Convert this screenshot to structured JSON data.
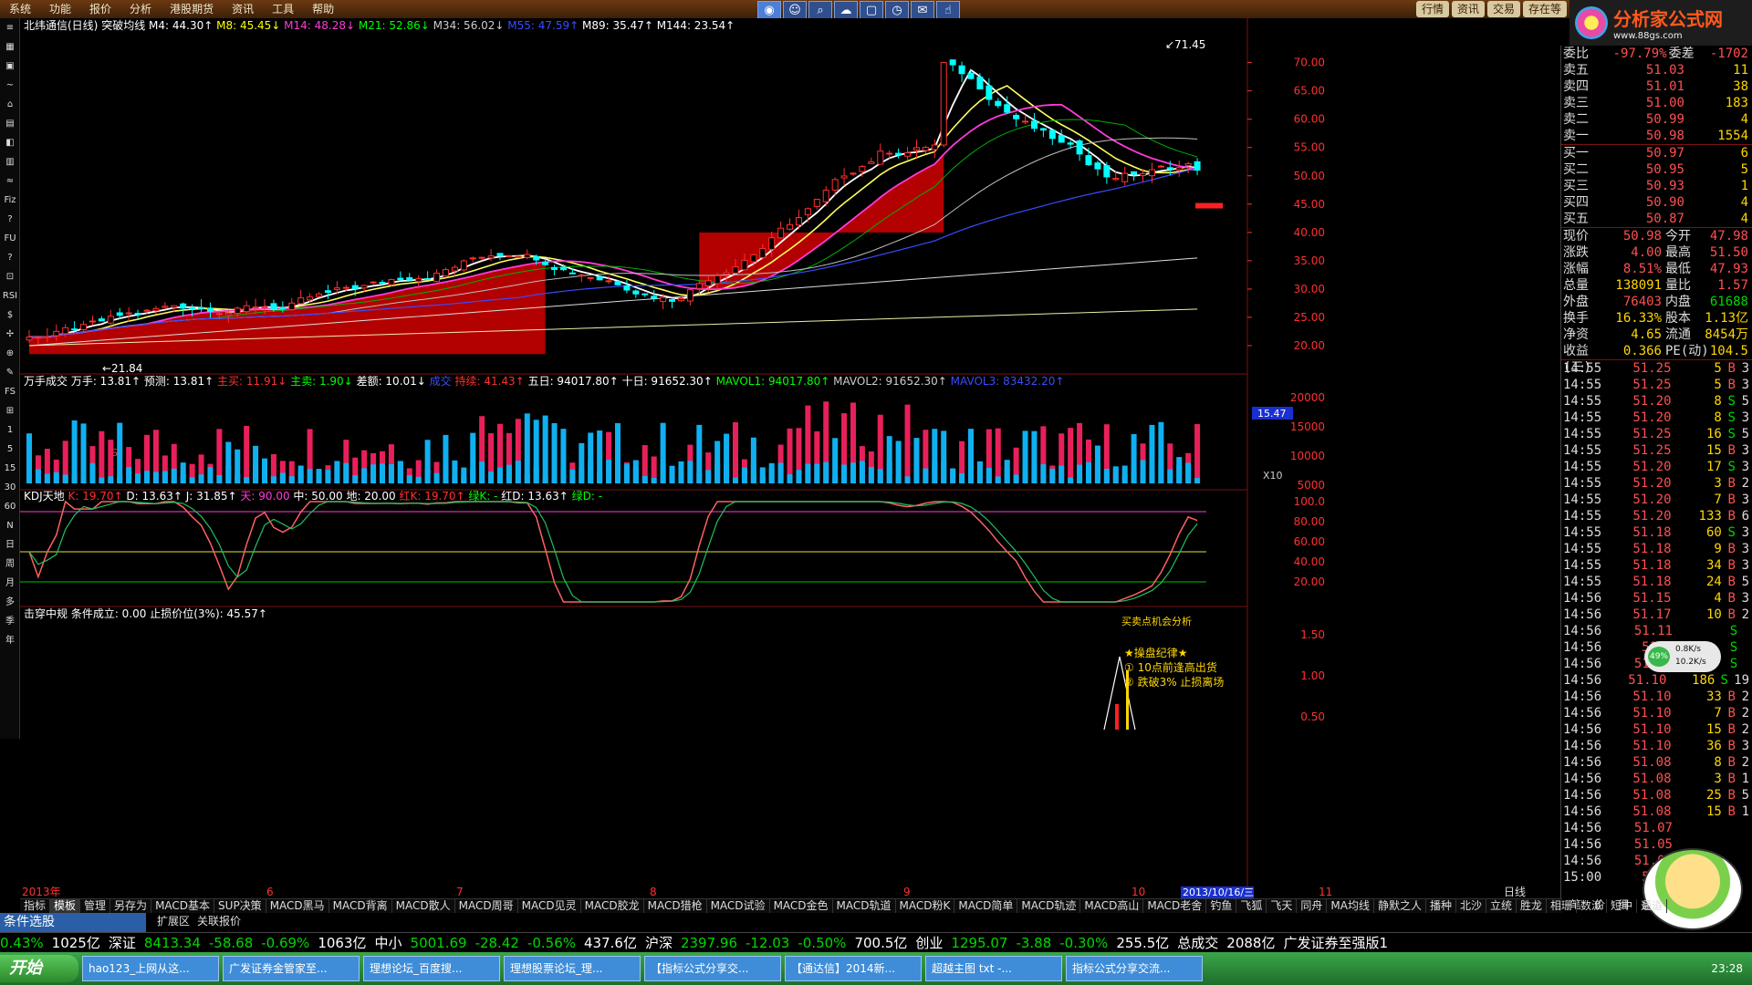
{
  "menu": [
    "系统",
    "功能",
    "报价",
    "分析",
    "港股期货",
    "资讯",
    "工具",
    "帮助"
  ],
  "top_tools": [
    "search-icon",
    "person-icon",
    "magnifier-icon",
    "cloud-icon",
    "window-icon",
    "clock-icon",
    "mail-icon",
    "gesture-icon"
  ],
  "top_tabs": [
    "行情",
    "资讯",
    "交易",
    "存在等"
  ],
  "logo": {
    "title": "分析家公式网",
    "url": "www.88gs.com"
  },
  "left_tools": [
    "≡",
    "▦",
    "▣",
    "~",
    "⌂",
    "▤",
    "◧",
    "▥",
    "≈",
    "Fiz",
    "?",
    "FU",
    "?",
    "⊡",
    "RSI",
    "$",
    "✢",
    "⊕",
    "✎",
    "FS",
    "⊞",
    "1",
    "5",
    "15",
    "30",
    "60",
    "N",
    "日",
    "周",
    "月",
    "多",
    "季",
    "年"
  ],
  "main_header": {
    "name": "北纬通信(日线)",
    "formula": "突破均线",
    "mas": [
      {
        "label": "M4: 44.30",
        "arrow": "↑",
        "color": "#ffffff"
      },
      {
        "label": "M8: 45.45",
        "arrow": "↓",
        "color": "#ffff00"
      },
      {
        "label": "M14: 48.28",
        "arrow": "↓",
        "color": "#ff3bd8"
      },
      {
        "label": "M21: 52.86",
        "arrow": "↓",
        "color": "#00ff00"
      },
      {
        "label": "M34: 56.02",
        "arrow": "↓",
        "color": "#cccccc"
      },
      {
        "label": "M55: 47.59",
        "arrow": "↑",
        "color": "#3a4cff"
      },
      {
        "label": "M89: 35.47",
        "arrow": "↑",
        "color": "#ffffff"
      },
      {
        "label": "M144: 23.54",
        "arrow": "↑",
        "color": "#ffffff"
      }
    ]
  },
  "vol_header": [
    {
      "t": "万手成交",
      "c": "#ffffff"
    },
    {
      "t": "万手: 13.81↑",
      "c": "#ffffff"
    },
    {
      "t": "预测: 13.81↑",
      "c": "#ffffff"
    },
    {
      "t": "主买: 11.91↓",
      "c": "#ff3030"
    },
    {
      "t": "主卖: 1.90↓",
      "c": "#00ff00"
    },
    {
      "t": "差额: 10.01↓",
      "c": "#ffffff"
    },
    {
      "t": "成交",
      "c": "#3a4cff"
    },
    {
      "t": "持续: 41.43↑",
      "c": "#ff3030"
    },
    {
      "t": "五日: 94017.80↑",
      "c": "#ffffff"
    },
    {
      "t": "十日: 91652.30↑",
      "c": "#ffffff"
    },
    {
      "t": "MAVOL1: 94017.80↑",
      "c": "#00ff00"
    },
    {
      "t": "MAVOL2: 91652.30↑",
      "c": "#cccccc"
    },
    {
      "t": "MAVOL3: 83432.20↑",
      "c": "#3a4cff"
    }
  ],
  "kdj_header": [
    {
      "t": "KDJ天地",
      "c": "#ffffff"
    },
    {
      "t": "K: 19.70↑",
      "c": "#ff3030"
    },
    {
      "t": "D: 13.63↑",
      "c": "#ffffff"
    },
    {
      "t": "J: 31.85↑",
      "c": "#ffffff"
    },
    {
      "t": "天: 90.00",
      "c": "#ff3bd8"
    },
    {
      "t": "中: 50.00",
      "c": "#ffffff"
    },
    {
      "t": "地: 20.00",
      "c": "#ffffff"
    },
    {
      "t": "红K: 19.70↑",
      "c": "#ff3030"
    },
    {
      "t": "绿K: -",
      "c": "#00ff00"
    },
    {
      "t": "红D: 13.63↑",
      "c": "#ffffff"
    },
    {
      "t": "绿D: -",
      "c": "#00ff00"
    }
  ],
  "sig_header": [
    {
      "t": "击穿中规",
      "c": "#ffffff"
    },
    {
      "t": "条件成立: 0.00",
      "c": "#ffffff"
    },
    {
      "t": "止损价位(3%): 45.57↑",
      "c": "#ffffff"
    }
  ],
  "sig_note": {
    "title": "★操盘纪律★",
    "l1": "① 10点前逢高出货",
    "l2": "② 跌破3% 止损离场",
    "partial": "买卖点机会分析"
  },
  "annotations": {
    "high": "71.45",
    "low": "21.84",
    "marker_s": "S",
    "price_tag": "15.47",
    "x10": "X10",
    "date_tag": "2013/10/16/三",
    "right_label": "日线"
  },
  "price_axis": [
    "70.00",
    "65.00",
    "60.00",
    "55.00",
    "50.00",
    "45.00",
    "40.00",
    "35.00",
    "30.00",
    "25.00",
    "20.00"
  ],
  "vol_axis": [
    "20000",
    "15000",
    "10000",
    "5000"
  ],
  "kdj_axis": [
    "100.0",
    "80.00",
    "60.00",
    "40.00",
    "20.00"
  ],
  "sig_axis": [
    "1.50",
    "1.00",
    "0.50"
  ],
  "month_labels": [
    "2013年",
    "6",
    "7",
    "8",
    "9",
    "10",
    "11"
  ],
  "colors": {
    "up": "#ff3030",
    "down": "#00ffff",
    "fill": "#b30000"
  },
  "quote": {
    "weibi": {
      "l": "委比",
      "v": "-97.79%",
      "l2": "委差",
      "v2": "-1702"
    },
    "sells": [
      {
        "l": "卖五",
        "p": "51.03",
        "v": "11"
      },
      {
        "l": "卖四",
        "p": "51.01",
        "v": "38"
      },
      {
        "l": "卖三",
        "p": "51.00",
        "v": "183"
      },
      {
        "l": "卖二",
        "p": "50.99",
        "v": "4"
      },
      {
        "l": "卖一",
        "p": "50.98",
        "v": "1554"
      }
    ],
    "buys": [
      {
        "l": "买一",
        "p": "50.97",
        "v": "6"
      },
      {
        "l": "买二",
        "p": "50.95",
        "v": "5"
      },
      {
        "l": "买三",
        "p": "50.93",
        "v": "1"
      },
      {
        "l": "买四",
        "p": "50.90",
        "v": "4"
      },
      {
        "l": "买五",
        "p": "50.87",
        "v": "4"
      }
    ],
    "stats": [
      {
        "a": "现价",
        "b": "50.98",
        "bc": "red",
        "c": "今开",
        "d": "47.98",
        "dc": "red"
      },
      {
        "a": "涨跌",
        "b": "4.00",
        "bc": "red",
        "c": "最高",
        "d": "51.50",
        "dc": "red"
      },
      {
        "a": "涨幅",
        "b": "8.51%",
        "bc": "red",
        "c": "最低",
        "d": "47.93",
        "dc": "red"
      },
      {
        "a": "总量",
        "b": "138091",
        "bc": "yellow",
        "c": "量比",
        "d": "1.57",
        "dc": "red"
      },
      {
        "a": "外盘",
        "b": "76403",
        "bc": "red",
        "c": "内盘",
        "d": "61688",
        "dc": "green"
      },
      {
        "a": "换手",
        "b": "16.33%",
        "bc": "yellow",
        "c": "股本",
        "d": "1.13亿",
        "dc": "yellow"
      },
      {
        "a": "净资",
        "b": "4.65",
        "bc": "yellow",
        "c": "流通",
        "d": "8454万",
        "dc": "yellow"
      },
      {
        "a": "收益(三)",
        "b": "0.366",
        "bc": "yellow",
        "c": "PE(动)",
        "d": "104.5",
        "dc": "yellow"
      }
    ],
    "ticks": [
      {
        "t": "14:55",
        "p": "51.25",
        "v": "5",
        "bs": "B",
        "n": "3"
      },
      {
        "t": "14:55",
        "p": "51.25",
        "v": "5",
        "bs": "B",
        "n": "3"
      },
      {
        "t": "14:55",
        "p": "51.20",
        "v": "8",
        "bs": "S",
        "n": "5"
      },
      {
        "t": "14:55",
        "p": "51.20",
        "v": "8",
        "bs": "S",
        "n": "3"
      },
      {
        "t": "14:55",
        "p": "51.25",
        "v": "16",
        "bs": "S",
        "n": "5"
      },
      {
        "t": "14:55",
        "p": "51.25",
        "v": "15",
        "bs": "B",
        "n": "3"
      },
      {
        "t": "14:55",
        "p": "51.20",
        "v": "17",
        "bs": "S",
        "n": "3"
      },
      {
        "t": "14:55",
        "p": "51.20",
        "v": "3",
        "bs": "B",
        "n": "2"
      },
      {
        "t": "14:55",
        "p": "51.20",
        "v": "7",
        "bs": "B",
        "n": "3"
      },
      {
        "t": "14:55",
        "p": "51.20",
        "v": "133",
        "bs": "B",
        "n": "6"
      },
      {
        "t": "14:55",
        "p": "51.18",
        "v": "60",
        "bs": "S",
        "n": "3"
      },
      {
        "t": "14:55",
        "p": "51.18",
        "v": "9",
        "bs": "B",
        "n": "3"
      },
      {
        "t": "14:55",
        "p": "51.18",
        "v": "34",
        "bs": "B",
        "n": "3"
      },
      {
        "t": "14:55",
        "p": "51.18",
        "v": "24",
        "bs": "B",
        "n": "5"
      },
      {
        "t": "14:56",
        "p": "51.15",
        "v": "4",
        "bs": "B",
        "n": "3"
      },
      {
        "t": "14:56",
        "p": "51.17",
        "v": "10",
        "bs": "B",
        "n": "2"
      },
      {
        "t": "14:56",
        "p": "51.11",
        "v": "",
        "bs": "S",
        "n": ""
      },
      {
        "t": "14:56",
        "p": "51.1",
        "v": "",
        "bs": "S",
        "n": ""
      },
      {
        "t": "14:56",
        "p": "51.15",
        "v": "",
        "bs": "S",
        "n": ""
      },
      {
        "t": "14:56",
        "p": "51.10",
        "v": "186",
        "bs": "S",
        "n": "19"
      },
      {
        "t": "14:56",
        "p": "51.10",
        "v": "33",
        "bs": "B",
        "n": "2"
      },
      {
        "t": "14:56",
        "p": "51.10",
        "v": "7",
        "bs": "B",
        "n": "2"
      },
      {
        "t": "14:56",
        "p": "51.10",
        "v": "15",
        "bs": "B",
        "n": "2"
      },
      {
        "t": "14:56",
        "p": "51.10",
        "v": "36",
        "bs": "B",
        "n": "3"
      },
      {
        "t": "14:56",
        "p": "51.08",
        "v": "8",
        "bs": "B",
        "n": "2"
      },
      {
        "t": "14:56",
        "p": "51.08",
        "v": "3",
        "bs": "B",
        "n": "1"
      },
      {
        "t": "14:56",
        "p": "51.08",
        "v": "25",
        "bs": "B",
        "n": "5"
      },
      {
        "t": "14:56",
        "p": "51.08",
        "v": "15",
        "bs": "B",
        "n": "1"
      },
      {
        "t": "14:56",
        "p": "51.07",
        "v": "",
        "bs": "",
        "n": ""
      },
      {
        "t": "14:56",
        "p": "51.05",
        "v": "",
        "bs": "",
        "n": ""
      },
      {
        "t": "14:56",
        "p": "51.05",
        "v": "",
        "bs": "",
        "n": ""
      },
      {
        "t": "15:00",
        "p": "50.9",
        "v": "",
        "bs": "",
        "n": ""
      }
    ],
    "speed": {
      "pct": "49%",
      "up": "0.8K/s",
      "down": "10.2K/s"
    },
    "bottom_tabs": [
      "笔",
      "价",
      "细",
      "盘"
    ]
  },
  "bottom_tabs": [
    "指标",
    "模板",
    "管理",
    "另存为",
    "MACD基本",
    "SUP决策",
    "MACD黑马",
    "MACD背离",
    "MACD散人",
    "MACD周哥",
    "MACD见灵",
    "MACD胶龙",
    "MACD猎枪",
    "MACD试验",
    "MACD金色",
    "MACD轨道",
    "MACD粉K",
    "MACD简单",
    "MACD轨迹",
    "MACD高山",
    "MACD老舍",
    "钓鱼",
    "飞狐",
    "飞天",
    "同舟",
    "MA均线",
    "静默之人",
    "播种",
    "北沙",
    "立统",
    "胜龙",
    "相珊",
    "数派",
    "短中",
    "通道"
  ],
  "sub_tabs": [
    "扩展区",
    "关联报价"
  ],
  "condition": "条件选股",
  "index_bar": [
    {
      "t": "0.43%",
      "c": "green"
    },
    {
      "t": "1025亿",
      "c": "white"
    },
    {
      "t": "深证",
      "c": "white"
    },
    {
      "t": "8413.34",
      "c": "green"
    },
    {
      "t": "-58.68",
      "c": "green"
    },
    {
      "t": "-0.69%",
      "c": "green"
    },
    {
      "t": "1063亿",
      "c": "white"
    },
    {
      "t": "中小",
      "c": "white"
    },
    {
      "t": "5001.69",
      "c": "green"
    },
    {
      "t": "-28.42",
      "c": "green"
    },
    {
      "t": "-0.56%",
      "c": "green"
    },
    {
      "t": "437.6亿",
      "c": "white"
    },
    {
      "t": "沪深",
      "c": "white"
    },
    {
      "t": "2397.96",
      "c": "green"
    },
    {
      "t": "-12.03",
      "c": "green"
    },
    {
      "t": "-0.50%",
      "c": "green"
    },
    {
      "t": "700.5亿",
      "c": "white"
    },
    {
      "t": "创业",
      "c": "white"
    },
    {
      "t": "1295.07",
      "c": "green"
    },
    {
      "t": "-3.88",
      "c": "green"
    },
    {
      "t": "-0.30%",
      "c": "green"
    },
    {
      "t": "255.5亿",
      "c": "white"
    },
    {
      "t": "总成交",
      "c": "white"
    },
    {
      "t": "2088亿",
      "c": "white"
    },
    {
      "t": "广发证券至强版1",
      "c": "white"
    }
  ],
  "taskbar": {
    "start": "开始",
    "tasks": [
      "hao123_上网从这...",
      "广发证券金管家至...",
      "理想论坛_百度搜...",
      "理想股票论坛_理...",
      "【指标公式分享交...",
      "【通达信】2014新...",
      "超越主图 txt -...",
      "指标公式分享交流..."
    ],
    "clock": "23:28"
  }
}
